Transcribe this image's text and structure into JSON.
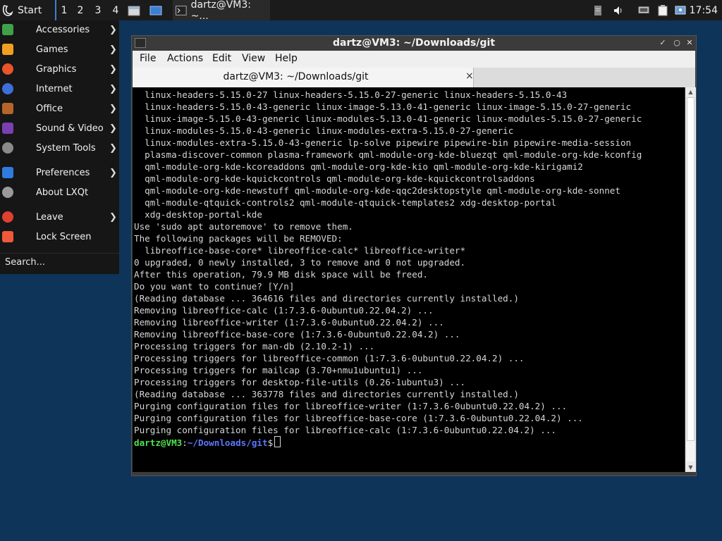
{
  "taskbar": {
    "start_label": "Start",
    "desktops": [
      "1",
      "2",
      "3",
      "4"
    ],
    "task_label": "dartz@VM3: ~...",
    "clock": "17:54"
  },
  "start_menu": {
    "items": [
      {
        "label": "Accessories",
        "icon": "accessories-icon",
        "color": "#3fa04a",
        "submenu": true
      },
      {
        "label": "Games",
        "icon": "games-icon",
        "color": "#f0a020",
        "submenu": true
      },
      {
        "label": "Graphics",
        "icon": "graphics-icon",
        "color": "#e8552a",
        "submenu": true
      },
      {
        "label": "Internet",
        "icon": "internet-icon",
        "color": "#3d6fd8",
        "submenu": true
      },
      {
        "label": "Office",
        "icon": "office-icon",
        "color": "#b5652a",
        "submenu": true
      },
      {
        "label": "Sound & Video",
        "icon": "sound-video-icon",
        "color": "#7a3fb0",
        "submenu": true
      },
      {
        "label": "System Tools",
        "icon": "system-tools-icon",
        "color": "#8a8a8a",
        "submenu": true
      },
      {
        "label": "Preferences",
        "icon": "preferences-icon",
        "color": "#2f7be0",
        "submenu": true
      },
      {
        "label": "About LXQt",
        "icon": "info-icon",
        "color": "#9a9a9a",
        "submenu": false
      },
      {
        "label": "Leave",
        "icon": "power-icon",
        "color": "#e04030",
        "submenu": true
      },
      {
        "label": "Lock Screen",
        "icon": "lock-icon",
        "color": "#f05a3a",
        "submenu": false
      }
    ],
    "search_placeholder": "Search..."
  },
  "window": {
    "title": "dartz@VM3: ~/Downloads/git",
    "menu": [
      "File",
      "Actions",
      "Edit",
      "View",
      "Help"
    ],
    "tab_label": "dartz@VM3: ~/Downloads/git",
    "tab_close": "×"
  },
  "terminal": {
    "lines": [
      "  linux-headers-5.15.0-27 linux-headers-5.15.0-27-generic linux-headers-5.15.0-43",
      "  linux-headers-5.15.0-43-generic linux-image-5.13.0-41-generic linux-image-5.15.0-27-generic",
      "  linux-image-5.15.0-43-generic linux-modules-5.13.0-41-generic linux-modules-5.15.0-27-generic",
      "  linux-modules-5.15.0-43-generic linux-modules-extra-5.15.0-27-generic",
      "  linux-modules-extra-5.15.0-43-generic lp-solve pipewire pipewire-bin pipewire-media-session",
      "  plasma-discover-common plasma-framework qml-module-org-kde-bluezqt qml-module-org-kde-kconfig",
      "  qml-module-org-kde-kcoreaddons qml-module-org-kde-kio qml-module-org-kde-kirigami2",
      "  qml-module-org-kde-kquickcontrols qml-module-org-kde-kquickcontrolsaddons",
      "  qml-module-org-kde-newstuff qml-module-org-kde-qqc2desktopstyle qml-module-org-kde-sonnet",
      "  qml-module-qtquick-controls2 qml-module-qtquick-templates2 xdg-desktop-portal",
      "  xdg-desktop-portal-kde",
      "Use 'sudo apt autoremove' to remove them.",
      "The following packages will be REMOVED:",
      "  libreoffice-base-core* libreoffice-calc* libreoffice-writer*",
      "0 upgraded, 0 newly installed, 3 to remove and 0 not upgraded.",
      "After this operation, 79.9 MB disk space will be freed.",
      "Do you want to continue? [Y/n]",
      "(Reading database ... 364616 files and directories currently installed.)",
      "Removing libreoffice-calc (1:7.3.6-0ubuntu0.22.04.2) ...",
      "Removing libreoffice-writer (1:7.3.6-0ubuntu0.22.04.2) ...",
      "Removing libreoffice-base-core (1:7.3.6-0ubuntu0.22.04.2) ...",
      "Processing triggers for man-db (2.10.2-1) ...",
      "Processing triggers for libreoffice-common (1:7.3.6-0ubuntu0.22.04.2) ...",
      "Processing triggers for mailcap (3.70+nmu1ubuntu1) ...",
      "Processing triggers for desktop-file-utils (0.26-1ubuntu3) ...",
      "(Reading database ... 363778 files and directories currently installed.)",
      "Purging configuration files for libreoffice-writer (1:7.3.6-0ubuntu0.22.04.2) ...",
      "Purging configuration files for libreoffice-base-core (1:7.3.6-0ubuntu0.22.04.2) ...",
      "Purging configuration files for libreoffice-calc (1:7.3.6-0ubuntu0.22.04.2) ..."
    ],
    "prompt": {
      "user": "dartz@VM3",
      "sep": ":",
      "path": "~/Downloads/git",
      "symbol": "$"
    }
  }
}
